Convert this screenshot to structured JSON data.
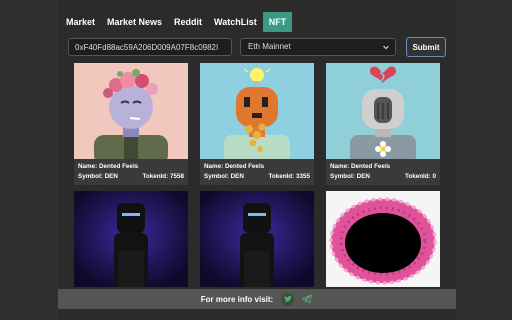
{
  "nav": {
    "tabs": [
      {
        "label": "Market"
      },
      {
        "label": "Market News"
      },
      {
        "label": "Reddit"
      },
      {
        "label": "WatchList"
      },
      {
        "label": "NFT"
      }
    ],
    "active": "NFT",
    "theme_icon": "moon-icon"
  },
  "form": {
    "address_value": "0xF40Fd88ac59A206D009A07F8c0982I",
    "network_selected": "Eth Mainnet",
    "submit_label": "Submit"
  },
  "nfts": [
    {
      "name_label": "Name: Dented Feels",
      "symbol_label": "Symbol: DEN",
      "token_label": "TokenId: 7558"
    },
    {
      "name_label": "Name: Dented Feels",
      "symbol_label": "Symbol: DEN",
      "token_label": "TokenId: 3355"
    },
    {
      "name_label": "Name: Dented Feels",
      "symbol_label": "Symbol: DEN",
      "token_label": "TokenId: 0"
    },
    {},
    {},
    {}
  ],
  "footer": {
    "text": "For more info visit:",
    "icons": [
      "twitter-icon",
      "telegram-icon"
    ]
  },
  "colors": {
    "accent": "#3a9a83",
    "background": "#2b2b2b",
    "card_meta": "#3a3a3a",
    "footer": "#555555"
  }
}
